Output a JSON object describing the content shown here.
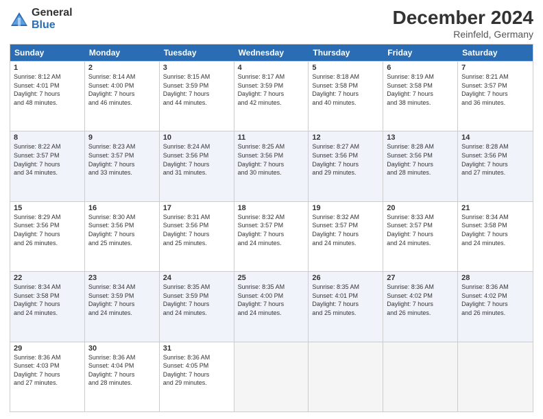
{
  "logo": {
    "line1": "General",
    "line2": "Blue"
  },
  "title": "December 2024",
  "subtitle": "Reinfeld, Germany",
  "days": [
    "Sunday",
    "Monday",
    "Tuesday",
    "Wednesday",
    "Thursday",
    "Friday",
    "Saturday"
  ],
  "weeks": [
    [
      {
        "num": "1",
        "info": "Sunrise: 8:12 AM\nSunset: 4:01 PM\nDaylight: 7 hours\nand 48 minutes."
      },
      {
        "num": "2",
        "info": "Sunrise: 8:14 AM\nSunset: 4:00 PM\nDaylight: 7 hours\nand 46 minutes."
      },
      {
        "num": "3",
        "info": "Sunrise: 8:15 AM\nSunset: 3:59 PM\nDaylight: 7 hours\nand 44 minutes."
      },
      {
        "num": "4",
        "info": "Sunrise: 8:17 AM\nSunset: 3:59 PM\nDaylight: 7 hours\nand 42 minutes."
      },
      {
        "num": "5",
        "info": "Sunrise: 8:18 AM\nSunset: 3:58 PM\nDaylight: 7 hours\nand 40 minutes."
      },
      {
        "num": "6",
        "info": "Sunrise: 8:19 AM\nSunset: 3:58 PM\nDaylight: 7 hours\nand 38 minutes."
      },
      {
        "num": "7",
        "info": "Sunrise: 8:21 AM\nSunset: 3:57 PM\nDaylight: 7 hours\nand 36 minutes."
      }
    ],
    [
      {
        "num": "8",
        "info": "Sunrise: 8:22 AM\nSunset: 3:57 PM\nDaylight: 7 hours\nand 34 minutes."
      },
      {
        "num": "9",
        "info": "Sunrise: 8:23 AM\nSunset: 3:57 PM\nDaylight: 7 hours\nand 33 minutes."
      },
      {
        "num": "10",
        "info": "Sunrise: 8:24 AM\nSunset: 3:56 PM\nDaylight: 7 hours\nand 31 minutes."
      },
      {
        "num": "11",
        "info": "Sunrise: 8:25 AM\nSunset: 3:56 PM\nDaylight: 7 hours\nand 30 minutes."
      },
      {
        "num": "12",
        "info": "Sunrise: 8:27 AM\nSunset: 3:56 PM\nDaylight: 7 hours\nand 29 minutes."
      },
      {
        "num": "13",
        "info": "Sunrise: 8:28 AM\nSunset: 3:56 PM\nDaylight: 7 hours\nand 28 minutes."
      },
      {
        "num": "14",
        "info": "Sunrise: 8:28 AM\nSunset: 3:56 PM\nDaylight: 7 hours\nand 27 minutes."
      }
    ],
    [
      {
        "num": "15",
        "info": "Sunrise: 8:29 AM\nSunset: 3:56 PM\nDaylight: 7 hours\nand 26 minutes."
      },
      {
        "num": "16",
        "info": "Sunrise: 8:30 AM\nSunset: 3:56 PM\nDaylight: 7 hours\nand 25 minutes."
      },
      {
        "num": "17",
        "info": "Sunrise: 8:31 AM\nSunset: 3:56 PM\nDaylight: 7 hours\nand 25 minutes."
      },
      {
        "num": "18",
        "info": "Sunrise: 8:32 AM\nSunset: 3:57 PM\nDaylight: 7 hours\nand 24 minutes."
      },
      {
        "num": "19",
        "info": "Sunrise: 8:32 AM\nSunset: 3:57 PM\nDaylight: 7 hours\nand 24 minutes."
      },
      {
        "num": "20",
        "info": "Sunrise: 8:33 AM\nSunset: 3:57 PM\nDaylight: 7 hours\nand 24 minutes."
      },
      {
        "num": "21",
        "info": "Sunrise: 8:34 AM\nSunset: 3:58 PM\nDaylight: 7 hours\nand 24 minutes."
      }
    ],
    [
      {
        "num": "22",
        "info": "Sunrise: 8:34 AM\nSunset: 3:58 PM\nDaylight: 7 hours\nand 24 minutes."
      },
      {
        "num": "23",
        "info": "Sunrise: 8:34 AM\nSunset: 3:59 PM\nDaylight: 7 hours\nand 24 minutes."
      },
      {
        "num": "24",
        "info": "Sunrise: 8:35 AM\nSunset: 3:59 PM\nDaylight: 7 hours\nand 24 minutes."
      },
      {
        "num": "25",
        "info": "Sunrise: 8:35 AM\nSunset: 4:00 PM\nDaylight: 7 hours\nand 24 minutes."
      },
      {
        "num": "26",
        "info": "Sunrise: 8:35 AM\nSunset: 4:01 PM\nDaylight: 7 hours\nand 25 minutes."
      },
      {
        "num": "27",
        "info": "Sunrise: 8:36 AM\nSunset: 4:02 PM\nDaylight: 7 hours\nand 26 minutes."
      },
      {
        "num": "28",
        "info": "Sunrise: 8:36 AM\nSunset: 4:02 PM\nDaylight: 7 hours\nand 26 minutes."
      }
    ],
    [
      {
        "num": "29",
        "info": "Sunrise: 8:36 AM\nSunset: 4:03 PM\nDaylight: 7 hours\nand 27 minutes."
      },
      {
        "num": "30",
        "info": "Sunrise: 8:36 AM\nSunset: 4:04 PM\nDaylight: 7 hours\nand 28 minutes."
      },
      {
        "num": "31",
        "info": "Sunrise: 8:36 AM\nSunset: 4:05 PM\nDaylight: 7 hours\nand 29 minutes."
      },
      null,
      null,
      null,
      null
    ]
  ]
}
